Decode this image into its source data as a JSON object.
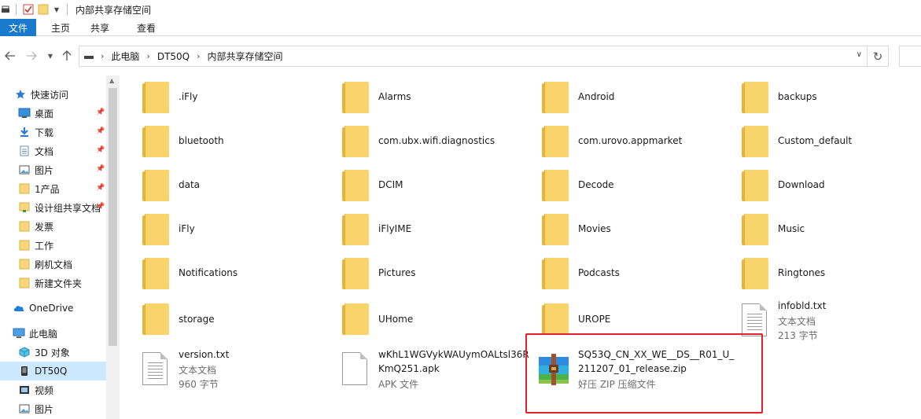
{
  "window": {
    "title": "内部共享存储空间"
  },
  "ribbon": {
    "tabs": [
      "文件",
      "主页",
      "共享",
      "查看"
    ]
  },
  "address": {
    "crumbs": [
      "此电脑",
      "DT50Q",
      "内部共享存储空间"
    ]
  },
  "sidebar": {
    "items": [
      {
        "label": "快速访问",
        "icon": "star-icon"
      },
      {
        "label": "桌面",
        "icon": "desktop-icon"
      },
      {
        "label": "下载",
        "icon": "download-icon"
      },
      {
        "label": "文档",
        "icon": "document-icon"
      },
      {
        "label": "图片",
        "icon": "pictures-icon"
      },
      {
        "label": "1产品",
        "icon": "folder-icon"
      },
      {
        "label": "设计组共享文档",
        "icon": "shared-folder-icon"
      },
      {
        "label": "发票",
        "icon": "folder-icon"
      },
      {
        "label": "工作",
        "icon": "folder-icon"
      },
      {
        "label": "刷机文档",
        "icon": "folder-icon"
      },
      {
        "label": "新建文件夹",
        "icon": "folder-icon"
      },
      {
        "label": "OneDrive",
        "icon": "cloud-icon"
      },
      {
        "label": "此电脑",
        "icon": "computer-icon"
      },
      {
        "label": "3D 对象",
        "icon": "cube-icon"
      },
      {
        "label": "DT50Q",
        "icon": "device-icon"
      },
      {
        "label": "视频",
        "icon": "video-icon"
      },
      {
        "label": "图片",
        "icon": "pictures-icon"
      }
    ]
  },
  "files": [
    {
      "name": ".iFly",
      "type": "folder"
    },
    {
      "name": "Alarms",
      "type": "folder"
    },
    {
      "name": "Android",
      "type": "folder"
    },
    {
      "name": "backups",
      "type": "folder"
    },
    {
      "name": "bluetooth",
      "type": "folder"
    },
    {
      "name": "com.ubx.wifi.diagnostics",
      "type": "folder"
    },
    {
      "name": "com.urovo.appmarket",
      "type": "folder"
    },
    {
      "name": "Custom_default",
      "type": "folder"
    },
    {
      "name": "data",
      "type": "folder"
    },
    {
      "name": "DCIM",
      "type": "folder"
    },
    {
      "name": "Decode",
      "type": "folder"
    },
    {
      "name": "Download",
      "type": "folder"
    },
    {
      "name": "iFly",
      "type": "folder"
    },
    {
      "name": "iFlyIME",
      "type": "folder"
    },
    {
      "name": "Movies",
      "type": "folder"
    },
    {
      "name": "Music",
      "type": "folder"
    },
    {
      "name": "Notifications",
      "type": "folder"
    },
    {
      "name": "Pictures",
      "type": "folder"
    },
    {
      "name": "Podcasts",
      "type": "folder"
    },
    {
      "name": "Ringtones",
      "type": "folder"
    },
    {
      "name": "storage",
      "type": "folder"
    },
    {
      "name": "UHome",
      "type": "folder"
    },
    {
      "name": "UROPE",
      "type": "folder"
    },
    {
      "name": "infobld.txt",
      "type": "text",
      "kind": "文本文档",
      "size": "213 字节"
    },
    {
      "name": "version.txt",
      "type": "text",
      "kind": "文本文档",
      "size": "960 字节"
    },
    {
      "name": "wKhL1WGVykWAUymOALtsl36R",
      "name2": "KmQ251.apk",
      "type": "apk",
      "kind": "APK 文件"
    },
    {
      "name": "SQ53Q_CN_XX_WE__DS__R01_U_",
      "name2": "211207_01_release.zip",
      "type": "zip",
      "kind": "好压 ZIP 压缩文件"
    }
  ],
  "colors": {
    "accent": "#1979ca",
    "selection": "#cce8ff",
    "highlight_box": "#e3222a",
    "folder": "#f9d46b"
  }
}
